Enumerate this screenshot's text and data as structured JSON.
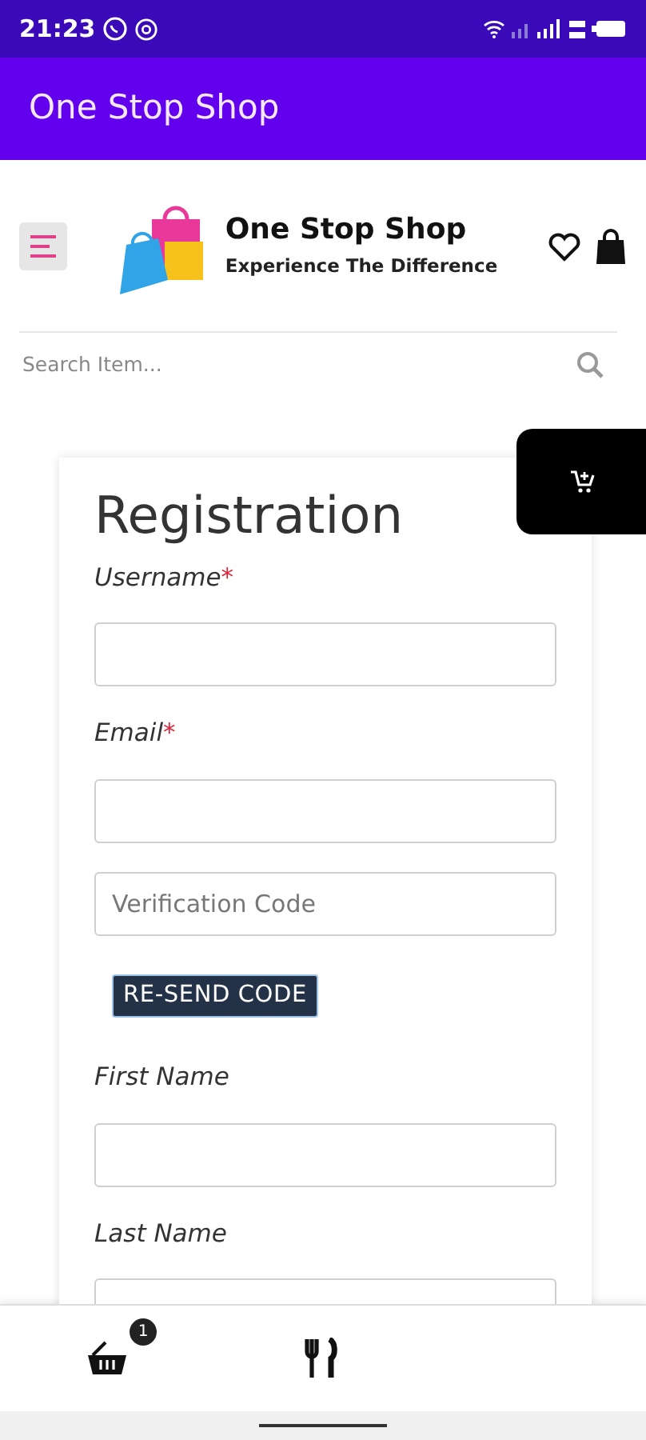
{
  "status_bar": {
    "time": "21:23"
  },
  "app_bar": {
    "title": "One Stop Shop"
  },
  "header": {
    "logo_title": "One Stop Shop",
    "logo_tagline": "Experience The Difference"
  },
  "search": {
    "placeholder": "Search Item..."
  },
  "form": {
    "title": "Registration",
    "items": [
      {
        "kind": "label",
        "text": "Username",
        "required_mark": "*"
      },
      {
        "kind": "input"
      },
      {
        "kind": "label",
        "text": "Email",
        "required_mark": "*"
      },
      {
        "kind": "input"
      },
      {
        "kind": "input",
        "placeholder": "Verification Code"
      },
      {
        "kind": "button",
        "text": "RE-SEND CODE"
      },
      {
        "kind": "label",
        "text": "First Name"
      },
      {
        "kind": "input"
      },
      {
        "kind": "label",
        "text": "Last Name"
      },
      {
        "kind": "input"
      }
    ]
  },
  "bottom_nav": {
    "basket_badge": "1"
  }
}
